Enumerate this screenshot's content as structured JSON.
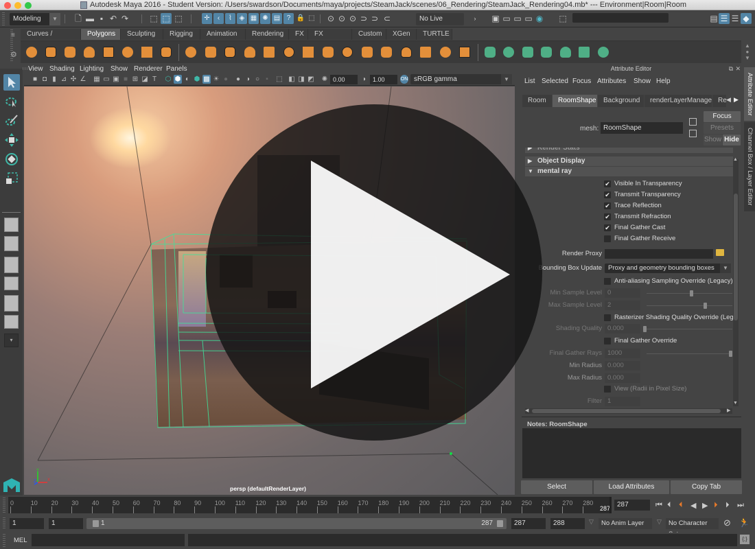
{
  "window": {
    "title": "Autodesk Maya 2016 - Student Version: /Users/swardson/Documents/maya/projects/SteamJack/scenes/06_Rendering/SteamJack_Rendering04.mb*   ---   Environment|Room|Room",
    "traffic_lights": {
      "close": "#fc5f57",
      "minimize": "#fdbc2e",
      "zoom": "#34c84a"
    }
  },
  "status_line": {
    "menu_set": "Modeling",
    "live_surface": "No Live Surface",
    "icons": [
      "new-scene",
      "open-scene",
      "save-scene",
      "undo",
      "redo",
      "select-by-hierarchy",
      "select-by-object",
      "select-by-component",
      "snap-grid",
      "snap-curve",
      "snap-point",
      "snap-view-plane",
      "snap-surface",
      "make-live",
      "help",
      "lock-selection",
      "highlight-selection",
      "construction-history",
      "input-ops",
      "output-ops",
      "render-view",
      "render-current",
      "ipr-render",
      "render-settings",
      "hypershade",
      "show-hide-modeling-toolkit"
    ]
  },
  "shelf": {
    "tabs": [
      "Curves / Surfaces",
      "Polygons",
      "Sculpting",
      "Rigging",
      "Animation",
      "Rendering",
      "FX",
      "FX Caching",
      "Custom",
      "XGen",
      "TURTLE"
    ],
    "active_tab": "Polygons",
    "icons": [
      "poly-sphere",
      "poly-cube",
      "poly-cylinder",
      "poly-cone",
      "poly-plane",
      "poly-torus",
      "poly-pyramid",
      "poly-pipe",
      "combine",
      "separate",
      "mirror",
      "smooth",
      "extract",
      "bevel",
      "multi-cut",
      "extrude",
      "bridge",
      "append",
      "insert-edge-loop",
      "add-divisions",
      "bounding-box-sel",
      "fill-hole",
      "split",
      "uv-planar",
      "uv-cylindrical",
      "uv-spherical",
      "uv-auto",
      "uv-contour",
      "uv-editor",
      "uv-unfold"
    ],
    "accent_orange": "#e38f3a",
    "accent_green": "#4faf86"
  },
  "viewport": {
    "menus": [
      "View",
      "Shading",
      "Lighting",
      "Show",
      "Renderer",
      "Panels"
    ],
    "exposure": "0.00",
    "gamma": "1.00",
    "color_space": "sRGB gamma",
    "camera_label": "persp (defaultRenderLayer)",
    "wireframe_color": "#3fe39a"
  },
  "attribute_editor": {
    "header": "Attribute Editor",
    "menus": [
      "List",
      "Selected",
      "Focus",
      "Attributes",
      "Show",
      "Help"
    ],
    "tabs": [
      "Room",
      "RoomShape",
      "Background",
      "renderLayerManager",
      "Re"
    ],
    "active_tab": "RoomShape",
    "mesh_label": "mesh:",
    "mesh_value": "RoomShape",
    "focus_button": "Focus",
    "presets_button": "Presets",
    "show_button": "Show",
    "hide_button": "Hide",
    "sections": {
      "render_stats": "Render Stats",
      "object_display": "Object Display",
      "mental_ray": "mental ray"
    },
    "checkboxes": [
      {
        "label": "Visible In Transparency",
        "checked": true
      },
      {
        "label": "Transmit Transparency",
        "checked": true
      },
      {
        "label": "Trace Reflection",
        "checked": true
      },
      {
        "label": "Transmit Refraction",
        "checked": true
      },
      {
        "label": "Final Gather Cast",
        "checked": true
      },
      {
        "label": "Final Gather Receive",
        "checked": false
      }
    ],
    "render_proxy_label": "Render Proxy",
    "render_proxy_value": "",
    "bbox_update_label": "Bounding Box Update",
    "bbox_update_value": "Proxy and geometry bounding boxes",
    "aa_override": {
      "label": "Anti-aliasing Sampling Override (Legacy)",
      "checked": false
    },
    "min_sample": {
      "label": "Min Sample Level",
      "value": "0"
    },
    "max_sample": {
      "label": "Max Sample Level",
      "value": "2"
    },
    "raster_override": {
      "label": "Rasterizer Shading Quality Override (Legacy)",
      "checked": false
    },
    "shading_quality": {
      "label": "Shading Quality",
      "value": "0.000"
    },
    "fg_override": {
      "label": "Final Gather Override",
      "checked": false
    },
    "fg_rays": {
      "label": "Final Gather Rays",
      "value": "1000"
    },
    "min_radius": {
      "label": "Min Radius",
      "value": "0.000"
    },
    "max_radius": {
      "label": "Max Radius",
      "value": "0.000"
    },
    "view_radii": {
      "label": "View (Radii in Pixel Size)",
      "checked": false
    },
    "filter": {
      "label": "Filter",
      "value": "1"
    },
    "notes_label": "Notes:  RoomShape",
    "notes_value": "",
    "bottom_buttons": [
      "Select",
      "Load Attributes",
      "Copy Tab"
    ]
  },
  "side_tabs": [
    "Attribute Editor",
    "Channel Box / Layer Editor"
  ],
  "timeline": {
    "ticks": [
      "0",
      "10",
      "20",
      "30",
      "40",
      "50",
      "60",
      "70",
      "80",
      "90",
      "100",
      "110",
      "120",
      "130",
      "140",
      "150",
      "160",
      "170",
      "180",
      "190",
      "200",
      "210",
      "220",
      "230",
      "240",
      "250",
      "260",
      "270",
      "280"
    ],
    "current_frame_marker": "287",
    "current_frame": "287",
    "playback_buttons": [
      "go-to-start",
      "step-back-frame",
      "step-back-key",
      "play-backwards",
      "play-forwards",
      "step-forward-key",
      "step-forward-frame",
      "go-to-end"
    ]
  },
  "range_slider": {
    "start": "1",
    "playback_start": "1",
    "range_start_label": "1",
    "range_end_label": "287",
    "playback_end": "287",
    "end": "288",
    "anim_layer": "No Anim Layer",
    "character_set": "No Character Set"
  },
  "command_line": {
    "language": "MEL",
    "input": "",
    "result": ""
  },
  "video_overlay": {
    "icon": "play-button-icon"
  }
}
